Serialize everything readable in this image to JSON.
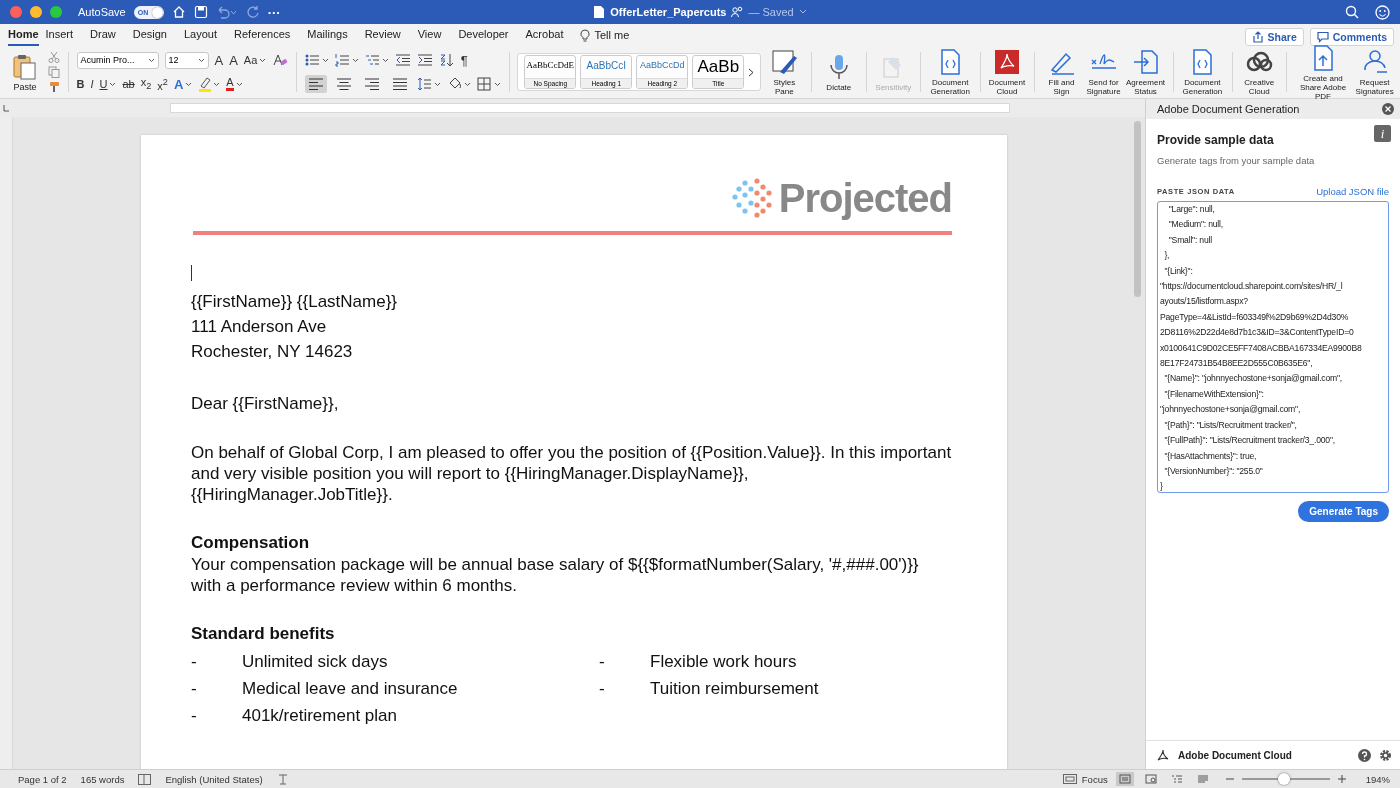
{
  "title_bar": {
    "autosave_label": "AutoSave",
    "autosave_on": true,
    "autosave_state": "ON",
    "more": "···",
    "document_title": "OfferLetter_Papercuts",
    "save_status": "— Saved"
  },
  "tabs": [
    {
      "label": "Home",
      "selected": true
    },
    {
      "label": "Insert",
      "selected": false
    },
    {
      "label": "Draw",
      "selected": false
    },
    {
      "label": "Design",
      "selected": false
    },
    {
      "label": "Layout",
      "selected": false
    },
    {
      "label": "References",
      "selected": false
    },
    {
      "label": "Mailings",
      "selected": false
    },
    {
      "label": "Review",
      "selected": false
    },
    {
      "label": "View",
      "selected": false
    },
    {
      "label": "Developer",
      "selected": false
    },
    {
      "label": "Acrobat",
      "selected": false
    }
  ],
  "tell_me": "Tell me",
  "tab_buttons": [
    {
      "label": "Share",
      "kind": "share"
    },
    {
      "label": "Comments",
      "kind": "comments"
    }
  ],
  "ribbon": {
    "paste": "Paste",
    "font_name": "Acumin Pro...",
    "font_size": "12",
    "font_glyphs": [
      {
        "text": "A",
        "kind": "grow"
      },
      {
        "text": "A",
        "kind": "shrink"
      },
      {
        "text": "Aa",
        "kind": "case"
      }
    ],
    "format_glyphs": [
      {
        "text": "B",
        "kind": "bold"
      },
      {
        "text": "I",
        "kind": "italic"
      },
      {
        "text": "U",
        "kind": "underline"
      },
      {
        "text": "ab",
        "kind": "strike"
      },
      {
        "text": "x$_{2}$",
        "kind": "sub"
      },
      {
        "text": "x$^{2}$",
        "kind": "super"
      },
      {
        "text": "A",
        "kind": "effects"
      },
      {
        "text": "A",
        "kind": "font-color"
      }
    ],
    "alignments": [
      {
        "kind": "left",
        "selected": true
      },
      {
        "kind": "center",
        "selected": false
      },
      {
        "kind": "right",
        "selected": false
      },
      {
        "kind": "justify",
        "selected": false
      }
    ],
    "pilcrow": "¶",
    "styles": [
      {
        "sample": "AaBbCcDdE",
        "label": "No Spacing",
        "kind": "plain"
      },
      {
        "sample": "AaBbCcI",
        "label": "Heading 1",
        "kind": "heading1"
      },
      {
        "sample": "AaBbCcDd",
        "label": "Heading 2",
        "kind": "heading2"
      },
      {
        "sample": "AaBb",
        "label": "Title",
        "kind": "title"
      }
    ],
    "buttons": [
      {
        "label": "Styles Pane",
        "kind": "styles",
        "disabled": false
      },
      {
        "label": "Dictate",
        "kind": "mic",
        "disabled": false
      },
      {
        "label": "Sensitivity",
        "kind": "sensitivity",
        "disabled": true
      },
      {
        "label": "Document Generation",
        "kind": "docgen",
        "disabled": false
      },
      {
        "label": "Document Cloud",
        "kind": "pdf",
        "disabled": false
      },
      {
        "label": "Fill and Sign",
        "kind": "pen",
        "disabled": false
      },
      {
        "label": "Send for Signature",
        "kind": "sign",
        "disabled": false
      },
      {
        "label": "Agreement Status",
        "kind": "status",
        "disabled": false
      },
      {
        "label": "Document Generation",
        "kind": "docgen",
        "disabled": false
      },
      {
        "label": "Creative Cloud",
        "kind": "cloud",
        "disabled": false
      },
      {
        "label": "Create and Share Adobe PDF",
        "kind": "share",
        "disabled": false
      },
      {
        "label": "Request Signatures",
        "kind": "person",
        "disabled": false
      }
    ]
  },
  "document": {
    "logo": "Projected",
    "blocks": [
      {
        "kind": "line",
        "text": "{{FirstName}} {{LastName}}"
      },
      {
        "kind": "line",
        "text": "111 Anderson Ave"
      },
      {
        "kind": "line",
        "text": "Rochester, NY 14623"
      },
      {
        "kind": "greeting",
        "text": "Dear {{FirstName}},"
      },
      {
        "kind": "paragraph",
        "text": "On behalf of Global Corp, I am pleased to offer you the position of {{Position.Value}}. In this important and very visible position you will report to {{HiringManager.DisplayName}}, {{HiringManager.JobTitle}}."
      },
      {
        "kind": "heading",
        "text": "Compensation"
      },
      {
        "kind": "body",
        "text": "Your compensation package will be annual base salary of ${{$formatNumber(Salary, '#,###.00')}} with a performance review within 6 months."
      },
      {
        "kind": "heading",
        "text": "Standard benefits"
      }
    ],
    "bullets": [
      {
        "marker": "-",
        "text": "Unlimited sick days"
      },
      {
        "marker": "-",
        "text": "Flexible work hours"
      },
      {
        "marker": "-",
        "text": "Medical leave and insurance"
      },
      {
        "marker": "-",
        "text": "Tuition reimbursement"
      },
      {
        "marker": "-",
        "text": "401k/retirement plan"
      }
    ]
  },
  "panel": {
    "title": "Adobe Document Generation",
    "info": "i",
    "heading": "Provide sample data",
    "subtitle": "Generate tags from your sample data",
    "field_label": "PASTE JSON DATA",
    "upload_link": "Upload JSON file",
    "json_lines": [
      "    \"Large\": null,",
      "    \"Medium\": null,",
      "    \"Small\": null",
      "  },",
      "  \"{Link}\":",
      "\"https://documentcloud.sharepoint.com/sites/HR/_l",
      "ayouts/15/listform.aspx?",
      "PageType=4&ListId=f603349f%2D9b69%2D4d30%",
      "2D8116%2D22d4e8d7b1c3&ID=3&ContentTypeID=0",
      "x0100641C9D02CE5FF7408ACBBA167334EA9900B8",
      "8E17F24731B54B8EE2D555C0B635E6\",",
      "  \"{Name}\": \"johnnyechostone+sonja@gmail.com\",",
      "  \"{FilenameWithExtension}\":",
      "\"johnnyechostone+sonja@gmail.com\",",
      "  \"{Path}\": \"Lists/Recruitment tracker/\",",
      "  \"{FullPath}\": \"Lists/Recruitment tracker/3_.000\",",
      "  \"{HasAttachments}\": true,",
      "  \"{VersionNumber}\": \"255.0\"",
      "}"
    ],
    "generate_button": "Generate Tags",
    "footer": "Adobe Document Cloud"
  },
  "status_bar": {
    "page": "Page 1 of 2",
    "words": "165 words",
    "language": "English (United States)",
    "focus": "Focus",
    "views": [
      {
        "kind": "print",
        "selected": true
      },
      {
        "kind": "web",
        "selected": false
      },
      {
        "kind": "outline",
        "selected": false
      },
      {
        "kind": "draft",
        "selected": false
      }
    ],
    "zoom": {
      "level": 0.48
    },
    "zoom_reading": "194%"
  }
}
